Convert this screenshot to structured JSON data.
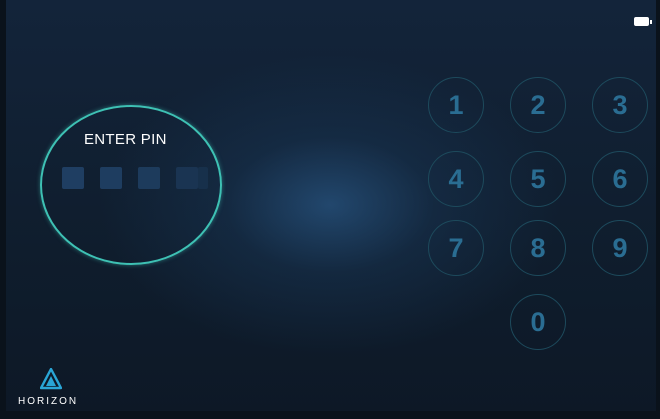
{
  "status_bar": {
    "battery_icon": "battery-full-icon"
  },
  "pin_panel": {
    "title": "ENTER PIN",
    "entered_digits": 0
  },
  "keypad": {
    "keys": [
      "1",
      "2",
      "3",
      "4",
      "5",
      "6",
      "7",
      "8",
      "9",
      "0"
    ]
  },
  "brand": {
    "name": "HORIZON",
    "logo_icon": "horizon-triangle-logo"
  },
  "colors": {
    "background": "#0f1d2c",
    "ring_accent": "#3ec1b4",
    "key_text": "#2a6d92",
    "key_border": "#1d4a5c",
    "logo_accent": "#2aa6d6"
  }
}
